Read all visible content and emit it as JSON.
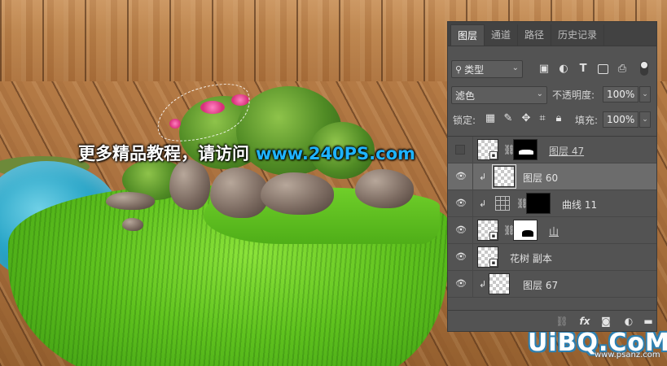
{
  "watermark": {
    "text": "更多精品教程，请访问",
    "url": "www.240PS.com"
  },
  "brand": {
    "logo": "UiBQ.CoM",
    "sub": "www.psanz.com"
  },
  "panel": {
    "tabs": [
      {
        "label": "图层",
        "active": true
      },
      {
        "label": "通道",
        "active": false
      },
      {
        "label": "路径",
        "active": false
      },
      {
        "label": "历史记录",
        "active": false
      }
    ],
    "filter": {
      "label": "类型",
      "icons": [
        "image-filter-icon",
        "adjustment-filter-icon",
        "text-filter-icon",
        "shape-filter-icon",
        "smart-object-filter-icon"
      ]
    },
    "blend_mode": "滤色",
    "opacity_label": "不透明度:",
    "opacity_value": "100%",
    "lock_label": "锁定:",
    "fill_label": "填充:",
    "fill_value": "100%",
    "layers": [
      {
        "name": "图层 47",
        "visible": false,
        "clipped": false,
        "type": "smart-with-mask",
        "mask": "black"
      },
      {
        "name": "图层 60",
        "visible": true,
        "clipped": true,
        "type": "pixel",
        "selected": true
      },
      {
        "name": "曲线 11",
        "visible": true,
        "clipped": true,
        "type": "adjustment-with-mask",
        "mask": "black"
      },
      {
        "name": "山",
        "visible": true,
        "clipped": false,
        "type": "smart-with-mask",
        "mask": "white"
      },
      {
        "name": "花树 副本",
        "visible": true,
        "clipped": false,
        "type": "smart"
      },
      {
        "name": "图层 67",
        "visible": true,
        "clipped": true,
        "type": "pixel"
      }
    ],
    "footer_icons": [
      "link-layers-icon",
      "fx-icon",
      "add-mask-icon",
      "adjustment-layer-icon",
      "group-folder-icon"
    ],
    "footer_fx_label": "fx"
  }
}
